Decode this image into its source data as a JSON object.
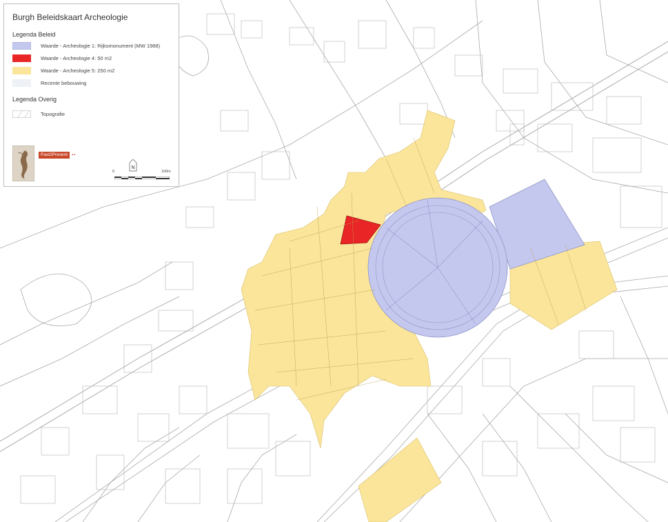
{
  "legend": {
    "title": "Burgh Beleidskaart Archeologie",
    "section_policy": "Legenda Beleid",
    "section_other": "Legenda Overig",
    "items": [
      {
        "label": "Waarde - Archeologie 1: Rijksmonument (MW 1988)",
        "color": "#c5c8ee"
      },
      {
        "label": "Waarde - Archeologie 4: 50 m2",
        "color": "#ea2525"
      },
      {
        "label": "Waarde - Archeologie 5: 250 m2",
        "color": "#fae59a"
      },
      {
        "label": "Recente bebouwing",
        "color": "#eef1f6"
      }
    ],
    "other_items": [
      {
        "label": "Topografie",
        "color": "#ffffff"
      }
    ]
  },
  "branding": {
    "text": "Past2Present",
    "accent": "#c8482a"
  },
  "north_arrow": {
    "label": "N"
  },
  "scale": {
    "start": "0",
    "end": "100m"
  },
  "colors": {
    "archeologie_1": "#c5c8ee",
    "archeologie_4": "#ea2525",
    "archeologie_5": "#fae59a",
    "topografie_lines": "#9a9a9a"
  }
}
